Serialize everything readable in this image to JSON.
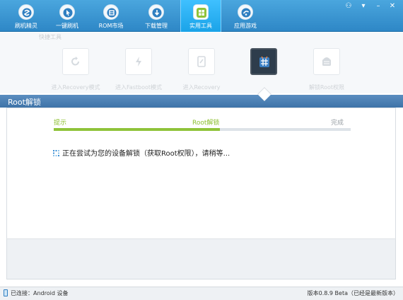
{
  "nav": {
    "items": [
      {
        "label": "刷机精灵"
      },
      {
        "label": "一键刷机"
      },
      {
        "label": "ROM市场"
      },
      {
        "label": "下载管理"
      },
      {
        "label": "实用工具"
      },
      {
        "label": "应用游戏"
      }
    ],
    "active_index": 4
  },
  "toolbar": {
    "title": "快捷工具",
    "items": [
      {
        "label": "进入Recovery模式"
      },
      {
        "label": "进入Fastboot模式"
      },
      {
        "label": "进入Recovery"
      },
      {
        "label": ""
      },
      {
        "label": "解锁Root权限"
      }
    ],
    "active_index": 3
  },
  "section": {
    "title": "Root解锁"
  },
  "steps": {
    "items": [
      "提示",
      "Root解锁",
      "完成"
    ],
    "progress_fraction": 0.56
  },
  "status": {
    "message": "正在尝试为您的设备解锁（获取Root权限），请稍等..."
  },
  "footer": {
    "connection": "已连接：Android 设备",
    "version": "版本0.8.9 Beta（已经是最新版本）"
  },
  "colors": {
    "nav": "#3a97d4",
    "nav_active": "#1aa3e8",
    "progress": "#8fc33a",
    "section_bar": "#4a80b6"
  }
}
